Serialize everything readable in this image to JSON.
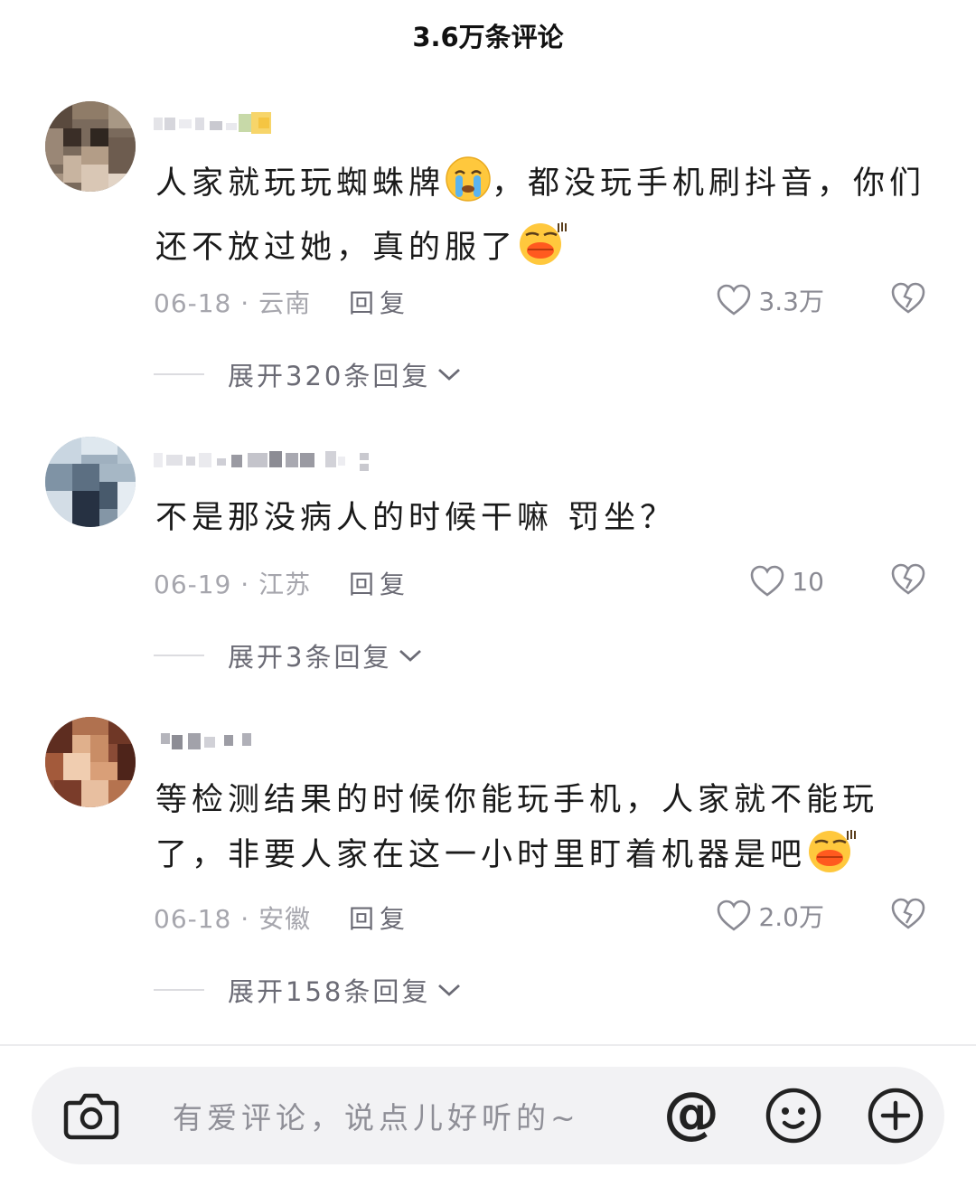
{
  "header": {
    "title": "3.6万条评论"
  },
  "comments": [
    {
      "text_before": "人家就玩玩蜘蛛牌",
      "text_mid": "，都没玩手机刷抖音，你们还不放过她，真的服了",
      "date_location": "06-18 · 云南",
      "reply_label": "回复",
      "likes": "3.3万",
      "expand_label": "展开320条回复"
    },
    {
      "text": "不是那没病人的时候干嘛 罚坐？",
      "date_location": "06-19 · 江苏",
      "reply_label": "回复",
      "likes": "10",
      "expand_label": "展开3条回复"
    },
    {
      "text": "等检测结果的时候你能玩手机，人家就不能玩了，非要人家在这一小时里盯着机器是吧",
      "date_location": "06-18 · 安徽",
      "reply_label": "回复",
      "likes": "2.0万",
      "expand_label": "展开158条回复"
    }
  ],
  "input": {
    "placeholder": "有爱评论，说点儿好听的~",
    "icons": [
      "camera-icon",
      "at-mention-icon",
      "emoji-icon",
      "plus-icon"
    ]
  }
}
